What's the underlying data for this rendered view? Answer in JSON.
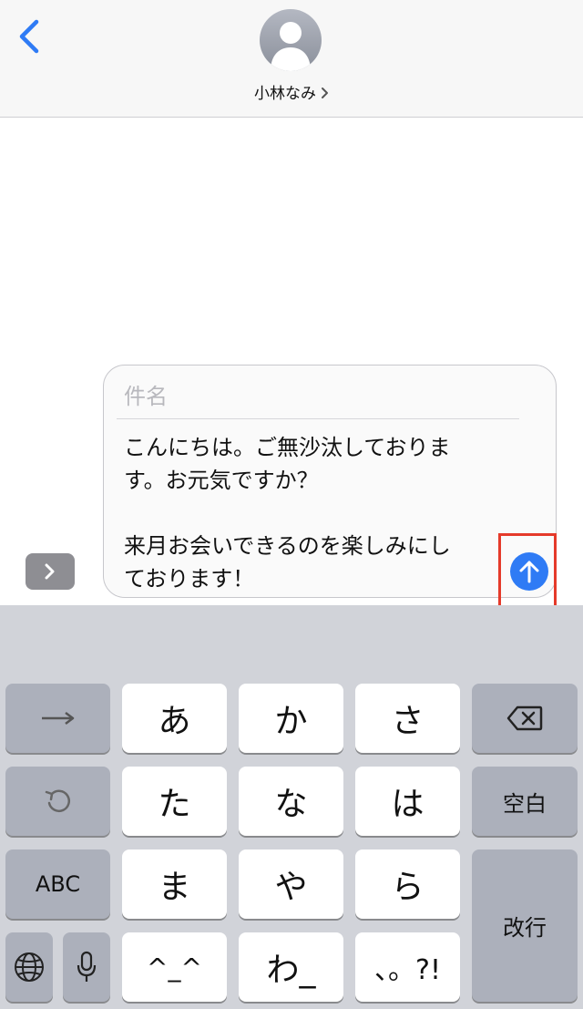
{
  "header": {
    "contact_name": "小林なみ"
  },
  "compose": {
    "subject_placeholder": "件名",
    "message": "こんにちは。ご無沙汰しておりま\nす。お元気ですか？\n\n来月お会いできるのを楽しみにし\nております！"
  },
  "keyboard": {
    "keys": {
      "a": "あ",
      "ka": "か",
      "sa": "さ",
      "ta": "た",
      "na": "な",
      "ha": "は",
      "ma": "ま",
      "ya": "や",
      "ra": "ら",
      "emoticon": "^_^",
      "wa": "わ_",
      "punct": "、。?!",
      "abc": "ABC",
      "space": "空白",
      "return": "改行"
    }
  },
  "colors": {
    "accent": "#2f7bf5",
    "highlight": "#e53a2a",
    "keyboard_bg": "#d1d3d9"
  },
  "icons": {
    "back": "chevron-left-icon",
    "send": "arrow-up-icon",
    "expand": "chevron-right-icon",
    "delete": "backspace-icon",
    "undo": "undo-icon",
    "next": "arrow-right-icon",
    "globe": "globe-icon",
    "mic": "microphone-icon"
  }
}
